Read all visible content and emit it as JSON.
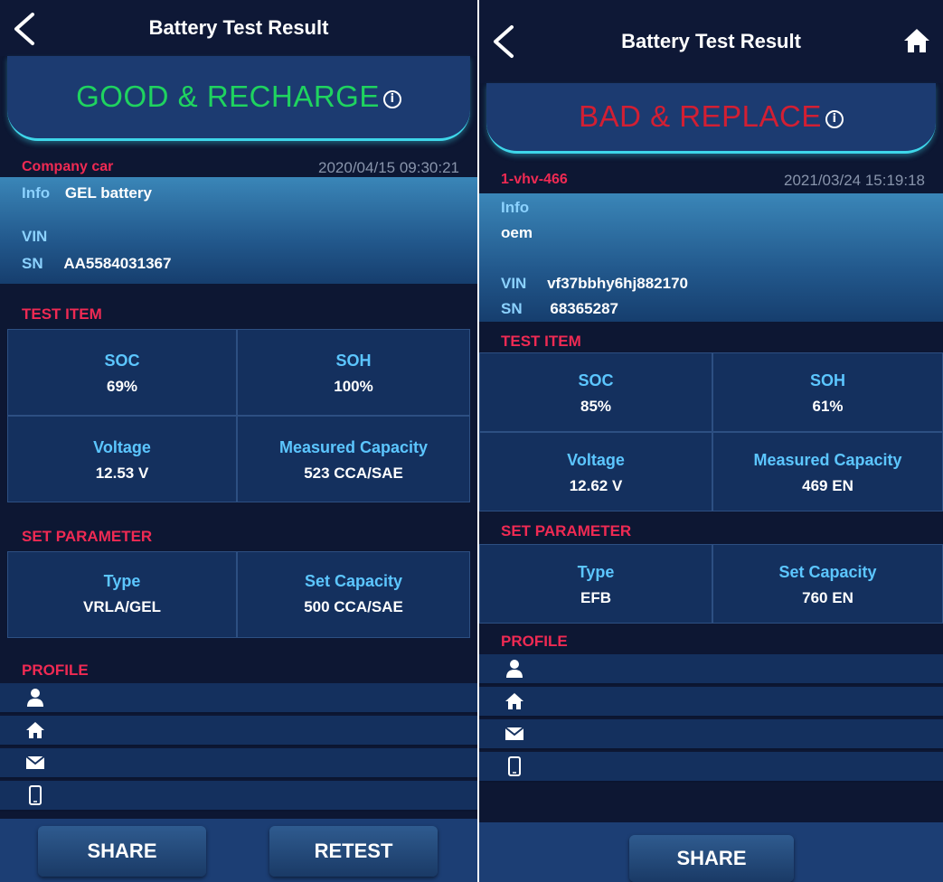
{
  "left": {
    "title": "Battery Test Result",
    "status": "GOOD & RECHARGE",
    "info_glyph": "i",
    "vehicle_name": "Company car",
    "timestamp": "2020/04/15 09:30:21",
    "details": {
      "info_label": "Info",
      "info_value": "GEL battery",
      "vin_label": "VIN",
      "vin_value": "",
      "sn_label": "SN",
      "sn_value": "AA5584031367"
    },
    "test_item_heading": "TEST ITEM",
    "test_items": [
      {
        "name": "SOC",
        "value": "69%"
      },
      {
        "name": "SOH",
        "value": "100%"
      },
      {
        "name": "Voltage",
        "value": "12.53 V"
      },
      {
        "name": "Measured Capacity",
        "value": "523 CCA/SAE"
      }
    ],
    "set_parameter_heading": "SET PARAMETER",
    "set_parameters": [
      {
        "name": "Type",
        "value": "VRLA/GEL"
      },
      {
        "name": "Set Capacity",
        "value": "500 CCA/SAE"
      }
    ],
    "profile_heading": "PROFILE",
    "profile_icons": [
      "person-icon",
      "home-icon",
      "mail-icon",
      "phone-icon"
    ],
    "buttons": {
      "share": "SHARE",
      "retest": "RETEST"
    }
  },
  "right": {
    "title": "Battery Test Result",
    "status": "BAD & REPLACE",
    "info_glyph": "i",
    "vehicle_name": "1-vhv-466",
    "timestamp": "2021/03/24 15:19:18",
    "details": {
      "info_label": "Info",
      "info_value": "oem",
      "vin_label": "VIN",
      "vin_value": "vf37bbhy6hj882170",
      "sn_label": "SN",
      "sn_value": "68365287"
    },
    "test_item_heading": "TEST ITEM",
    "test_items": [
      {
        "name": "SOC",
        "value": "85%"
      },
      {
        "name": "SOH",
        "value": "61%"
      },
      {
        "name": "Voltage",
        "value": "12.62 V"
      },
      {
        "name": "Measured Capacity",
        "value": "469 EN"
      }
    ],
    "set_parameter_heading": "SET PARAMETER",
    "set_parameters": [
      {
        "name": "Type",
        "value": "EFB"
      },
      {
        "name": "Set Capacity",
        "value": "760 EN"
      }
    ],
    "profile_heading": "PROFILE",
    "profile_icons": [
      "person-icon",
      "home-icon",
      "mail-icon",
      "phone-icon"
    ],
    "buttons": {
      "share": "SHARE"
    }
  },
  "colors": {
    "background": "#0d1733",
    "banner": "#1c3b71",
    "banner_edge": "#3ed7ea",
    "good": "#1fd35f",
    "bad": "#d21f33",
    "heading_red": "#ef2a53",
    "cell_label": "#5cc6ff",
    "detail_label": "#8cd2ff"
  }
}
